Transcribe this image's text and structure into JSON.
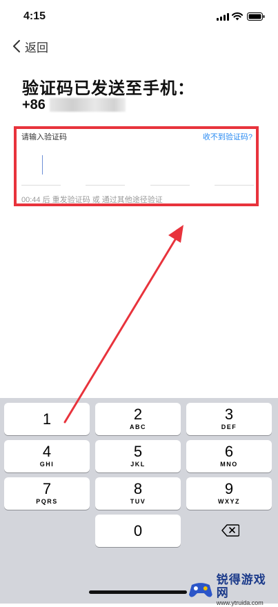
{
  "status_bar": {
    "time": "4:15"
  },
  "nav": {
    "back_label": "返回"
  },
  "title": "验证码已发送至手机：",
  "phone": {
    "prefix": "+86"
  },
  "code_input": {
    "label": "请输入验证码",
    "help_link": "收不到验证码?",
    "slots": 4,
    "resend_text": "00:44 后 重发验证码 或 通过其他途径验证"
  },
  "annotation": {
    "box_color": "#e8333c",
    "arrow_color": "#e8333c"
  },
  "keypad": {
    "keys": [
      {
        "digit": "1",
        "letters": ""
      },
      {
        "digit": "2",
        "letters": "ABC"
      },
      {
        "digit": "3",
        "letters": "DEF"
      },
      {
        "digit": "4",
        "letters": "GHI"
      },
      {
        "digit": "5",
        "letters": "JKL"
      },
      {
        "digit": "6",
        "letters": "MNO"
      },
      {
        "digit": "7",
        "letters": "PQRS"
      },
      {
        "digit": "8",
        "letters": "TUV"
      },
      {
        "digit": "9",
        "letters": "WXYZ"
      },
      {
        "digit": "0",
        "letters": ""
      }
    ],
    "delete_icon": "backspace-icon"
  },
  "watermark": {
    "title": "锐得游戏网",
    "url": "www.ytruida.com"
  }
}
